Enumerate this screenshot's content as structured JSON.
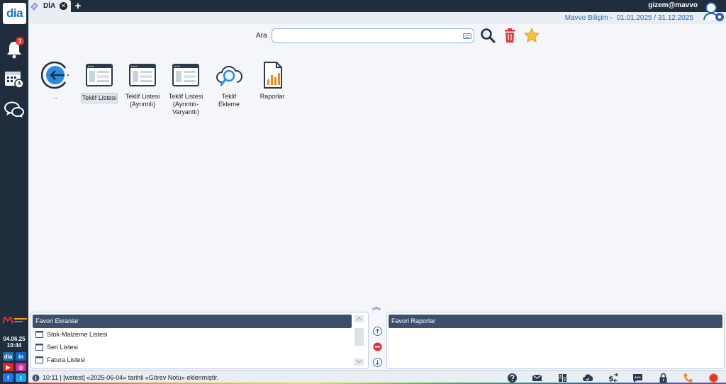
{
  "app": {
    "logo_text": "dia",
    "tab_label": "DİA",
    "tab_add": "+",
    "user": "gizem@mavvo"
  },
  "header": {
    "company": "Mavvo Bilişim -",
    "period": "01.01.2025 / 31.12.2025"
  },
  "sidebar": {
    "notification_count": "3",
    "date": "04.06.25",
    "time": "10:44",
    "social": [
      "dia",
      "in",
      "▶",
      "◎",
      "f",
      "t"
    ]
  },
  "search": {
    "label": "Ara",
    "placeholder": "",
    "value": ""
  },
  "grid": {
    "items": [
      {
        "label": ".."
      },
      {
        "label": "Teklif Listesi"
      },
      {
        "label": "Teklif Listesi (Ayrıntılı)"
      },
      {
        "label": "Teklif Listesi (Ayrıntılı-Varyantlı)"
      },
      {
        "label": "Teklif Ekleme"
      },
      {
        "label": "Raporlar"
      }
    ]
  },
  "favorites": {
    "title": "Favori Ekranlar",
    "items": [
      "Stok-Malzeme Listesi",
      "Seri Listesi",
      "Fatura Listesi"
    ]
  },
  "reports": {
    "title": "Favori Raporlar"
  },
  "status": {
    "message": "10:11 | [wstest] «2025-06-04» tarihli «Görev Notu» eklenmiştir."
  },
  "colors": {
    "accent": "#1d6fb8",
    "sidebar": "#1f2d3d",
    "panel_head": "#3c4f6b",
    "danger": "#e5303a"
  }
}
